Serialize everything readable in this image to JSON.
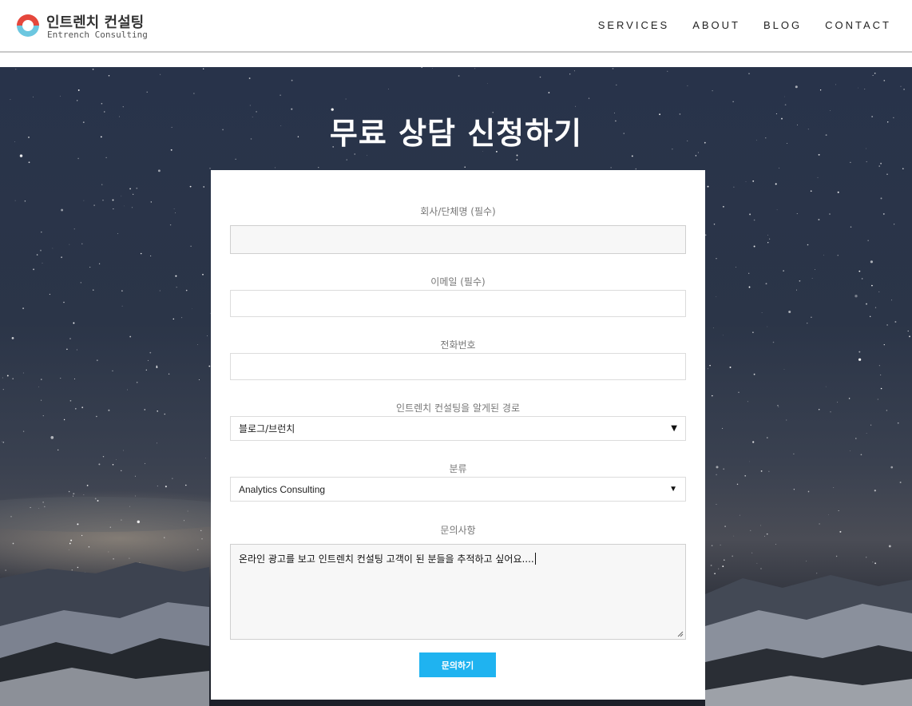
{
  "brand": {
    "title": "인트렌치 컨설팅",
    "subtitle": "Entrench Consulting",
    "colors": {
      "logo_red": "#e5473c",
      "logo_blue": "#6cc7e0"
    }
  },
  "nav": [
    {
      "label": "SERVICES"
    },
    {
      "label": "ABOUT"
    },
    {
      "label": "BLOG"
    },
    {
      "label": "CONTACT"
    }
  ],
  "page": {
    "title": "무료 상담 신청하기"
  },
  "form": {
    "company": {
      "label": "회사/단체명 (필수)",
      "value": ""
    },
    "email": {
      "label": "이메일 (필수)",
      "value": ""
    },
    "phone": {
      "label": "전화번호",
      "value": ""
    },
    "source": {
      "label": "인트렌치 컨설팅을 알게된 경로",
      "selected": "블로그/브런치"
    },
    "category": {
      "label": "분류",
      "selected": "Analytics Consulting"
    },
    "inquiry": {
      "label": "문의사항",
      "value": "온라인 광고를 보고 인트렌치 컨설팅 고객이 된 분들을 추적하고 싶어요...."
    },
    "submit_label": "문의하기"
  },
  "colors": {
    "accent": "#1fb3f0",
    "header_bg": "#ffffff"
  },
  "icons": {
    "select_caret": "triangle-down-icon",
    "resize": "resize-grip-icon"
  }
}
